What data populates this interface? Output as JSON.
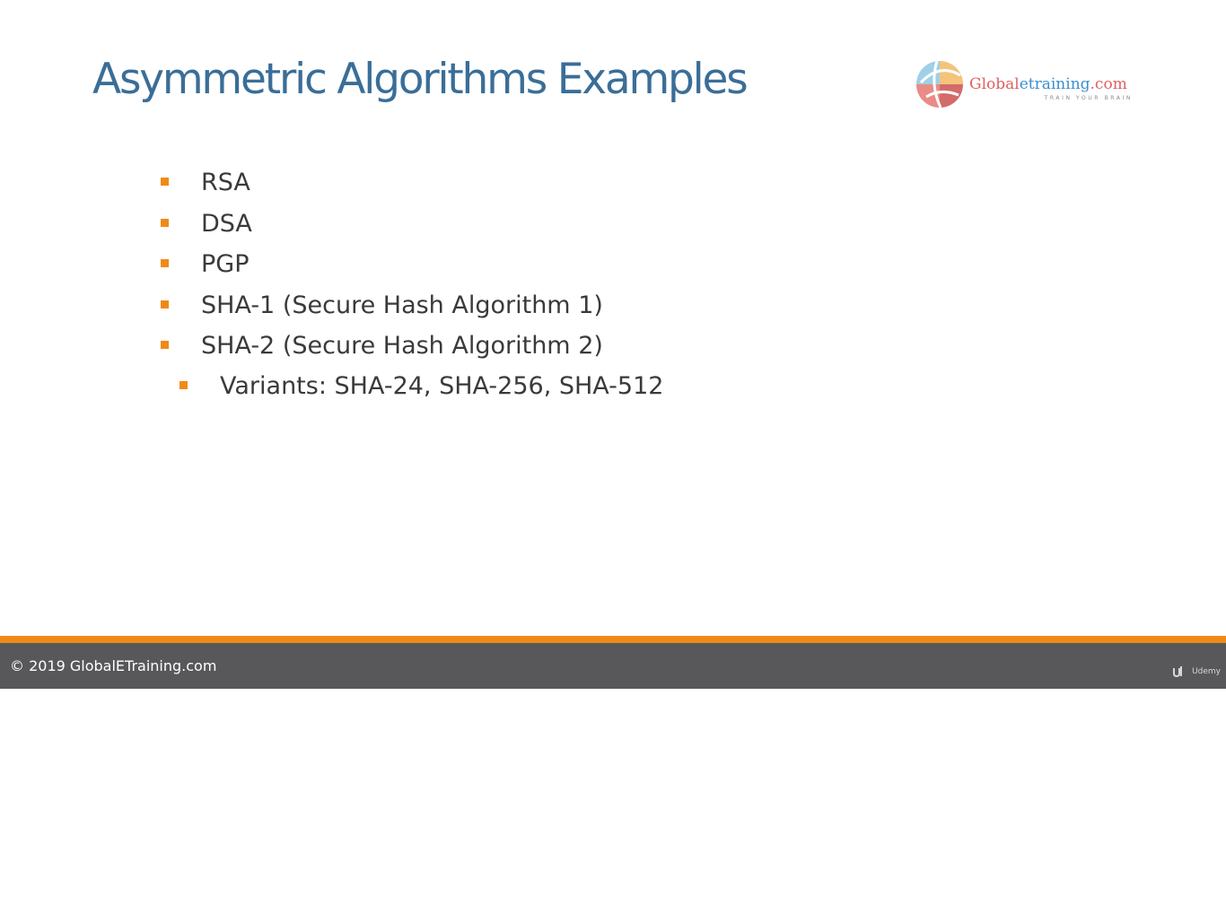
{
  "slide": {
    "title": "Asymmetric Algorithms Examples",
    "logo": {
      "name_part1": "Global",
      "name_part2": "etraining",
      "name_part3": ".com",
      "tagline": "TRAIN YOUR BRAIN"
    },
    "bullets": [
      {
        "text": "RSA",
        "level": 1
      },
      {
        "text": "DSA",
        "level": 1
      },
      {
        "text": "PGP",
        "level": 1
      },
      {
        "text": "SHA-1 (Secure Hash Algorithm 1)",
        "level": 1
      },
      {
        "text": "SHA-2 (Secure Hash Algorithm 2)",
        "level": 1
      },
      {
        "text": "Variants: SHA-24, SHA-256, SHA-512",
        "level": 2
      }
    ],
    "footer": {
      "copyright": "© 2019 GlobalETraining.com",
      "watermark": "Udemy"
    }
  },
  "colors": {
    "title": "#3a6e98",
    "accent": "#ef8a17",
    "footer_bar": "#58585a",
    "body_text": "#3a3a3a",
    "logo_red": "#e06060",
    "logo_blue": "#3a8fd0"
  }
}
